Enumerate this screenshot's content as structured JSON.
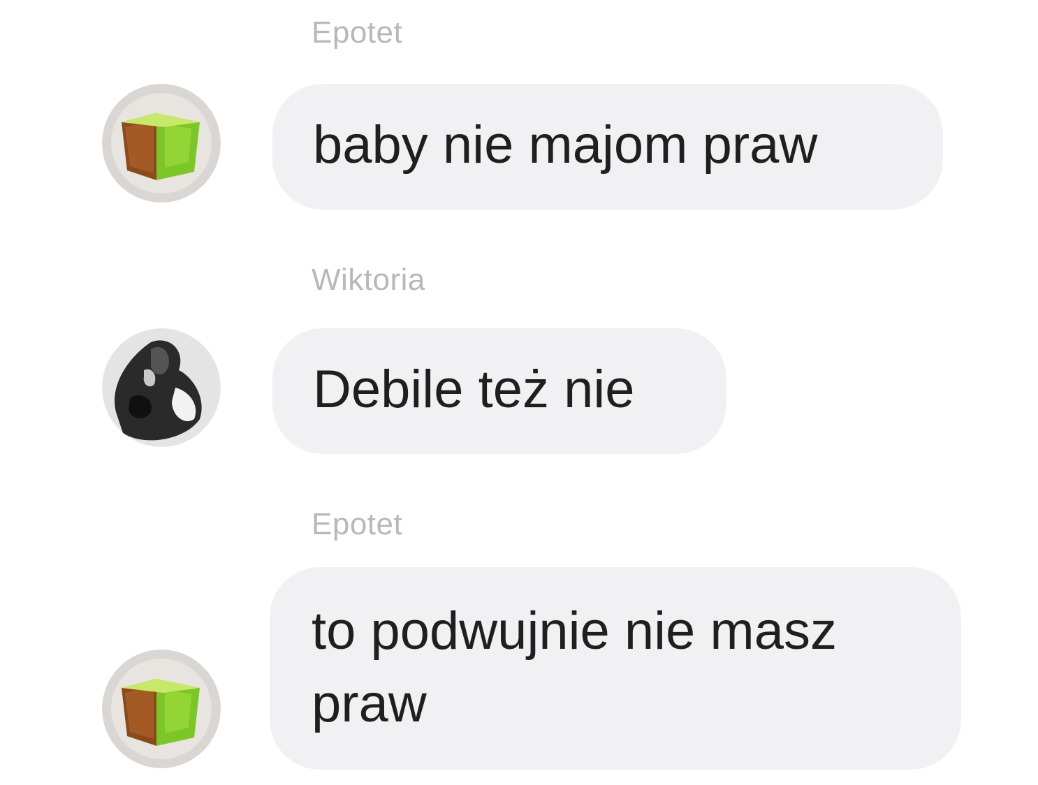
{
  "messages": [
    {
      "sender": "Epotet",
      "text": "baby nie majom praw",
      "avatar_icon": "green-cube-avatar"
    },
    {
      "sender": "Wiktoria",
      "text": "Debile też nie",
      "avatar_icon": "bw-photo-avatar"
    },
    {
      "sender": "Epotet",
      "text": "to podwujnie nie masz praw",
      "avatar_icon": "green-cube-avatar"
    }
  ],
  "colors": {
    "background": "#ffffff",
    "bubble": "#f1f1f3",
    "sender_text": "#b8b8b8",
    "message_text": "#1f1f1f",
    "cube_green": "#7cc62a",
    "cube_brown": "#8a4a1c"
  }
}
